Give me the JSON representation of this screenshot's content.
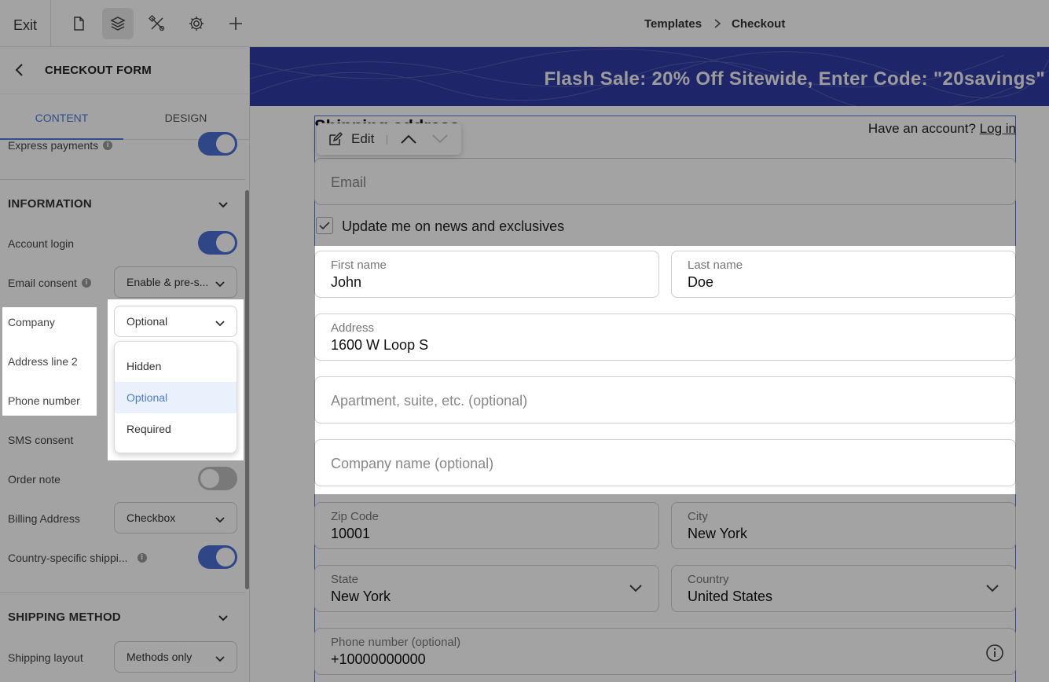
{
  "topbar": {
    "exit_label": "Exit",
    "icons": [
      "page-icon",
      "layers-icon",
      "tools-icon",
      "gear-icon",
      "plus-icon"
    ],
    "breadcrumb": [
      "Templates",
      "Checkout"
    ]
  },
  "panel": {
    "title": "CHECKOUT FORM",
    "tabs": [
      "CONTENT",
      "DESIGN"
    ],
    "express_payments_label": "Express payments",
    "information": {
      "title": "INFORMATION",
      "account_login": "Account login",
      "email_consent": "Email consent",
      "email_consent_value": "Enable & pre-s...",
      "company": "Company",
      "company_value": "Optional",
      "address_line2": "Address line 2",
      "phone_number": "Phone number",
      "sms_consent": "SMS consent",
      "order_note": "Order note",
      "billing_address": "Billing Address",
      "billing_address_value": "Checkbox",
      "country_specific": "Country-specific shippi..."
    },
    "dropdown_options": [
      "Hidden",
      "Optional",
      "Required"
    ],
    "dropdown_selected": "Optional",
    "shipping_method": {
      "title": "SHIPPING METHOD",
      "layout_label": "Shipping layout",
      "layout_value": "Methods only"
    }
  },
  "canvas": {
    "banner": "Flash Sale: 20% Off Sitewide, Enter Code: \"20savings\"",
    "shipping_heading": "Shipping address",
    "have_account": "Have an account?",
    "log_in": "Log in",
    "edit_label": "Edit",
    "email_placeholder": "Email",
    "news_checkbox": "Update me on news and exclusives",
    "first_name_label": "First name",
    "first_name": "John",
    "last_name_label": "Last name",
    "last_name": "Doe",
    "address_label": "Address",
    "address": "1600 W Loop S",
    "apartment_placeholder": "Apartment, suite, etc. (optional)",
    "company_placeholder": "Company name (optional)",
    "zip_label": "Zip Code",
    "zip": "10001",
    "city_label": "City",
    "city": "New York",
    "state_label": "State",
    "state": "New York",
    "country_label": "Country",
    "country": "United States",
    "phone_label": "Phone number (optional)",
    "phone": "+10000000000"
  },
  "colors": {
    "accent": "#4a6ed3",
    "tab_active": "#4a7bd9",
    "banner": "#2f3aa3"
  }
}
